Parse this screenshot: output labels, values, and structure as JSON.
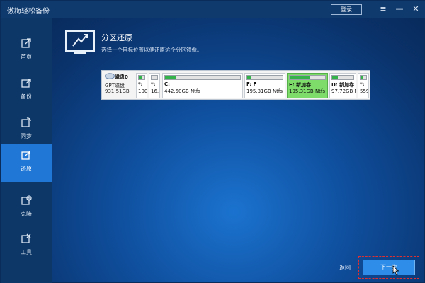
{
  "app": {
    "title": "傲梅轻松备份",
    "login_label": "登录"
  },
  "window_controls": {
    "menu": "≡",
    "minimize": "—",
    "close": "✕"
  },
  "sidebar": {
    "items": [
      {
        "label": "首页",
        "icon": "home-icon"
      },
      {
        "label": "备份",
        "icon": "backup-icon"
      },
      {
        "label": "同步",
        "icon": "sync-icon"
      },
      {
        "label": "还原",
        "icon": "restore-icon",
        "active": true
      },
      {
        "label": "克隆",
        "icon": "clone-icon"
      },
      {
        "label": "工具",
        "icon": "tools-icon"
      }
    ]
  },
  "header": {
    "title": "分区还原",
    "subtitle": "选择一个目标位置以便还原这个分区镜像。"
  },
  "disk": {
    "name": "磁盘0",
    "type": "GPT磁盘",
    "size": "931.51GB",
    "partitions": [
      {
        "name": "*:",
        "size": "100.",
        "used": 0.55
      },
      {
        "name": "*:",
        "size": "16.0",
        "used": 0.1
      },
      {
        "name": "C:",
        "size": "442.50GB Ntfs",
        "used": 0.14
      },
      {
        "name": "F: F",
        "size": "195.31GB Ntfs",
        "used": 0.1
      },
      {
        "name": "E: 新加卷",
        "size": "195.31GB Ntfs",
        "used": 0.55,
        "selected": true
      },
      {
        "name": "D: 新加卷",
        "size": "97.72GB Ntfs",
        "used": 0.25
      },
      {
        "name": "*:",
        "size": "559.",
        "used": 0.55
      }
    ]
  },
  "footer": {
    "back_label": "返回",
    "next_label": "下一步"
  },
  "colors": {
    "accent": "#2077d6",
    "selected_partition": "#7edc6a",
    "used_bar": "#34b34a"
  }
}
